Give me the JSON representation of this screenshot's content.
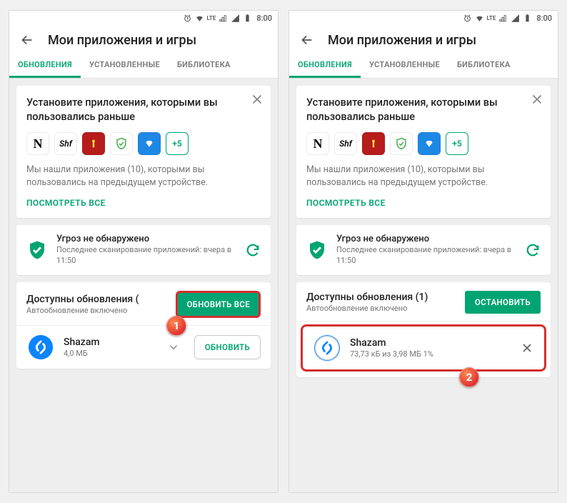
{
  "status": {
    "time": "8:00",
    "lte": "LTE"
  },
  "header": {
    "title": "Мои приложения и игры"
  },
  "tabs": {
    "updates": "ОБНОВЛЕНИЯ",
    "installed": "УСТАНОВЛЕННЫЕ",
    "library": "БИБЛИОТЕКА"
  },
  "suggest": {
    "title": "Установите приложения, которыми вы пользовались раньше",
    "more": "+5",
    "desc": "Мы нашли приложения (10), которыми вы пользовались на предыдущем устройстве.",
    "view_all": "ПОСМОТРЕТЬ ВСЕ"
  },
  "scan": {
    "title": "Угроз не обнаружено",
    "sub": "Последнее сканирование приложений: вчера в 11:50"
  },
  "left": {
    "upd_title": "Доступны обновления (",
    "upd_sub": "Автообновление включено",
    "btn_all": "ОБНОВИТЬ ВСЕ",
    "app_name": "Shazam",
    "app_sub": "4,0 МБ",
    "btn_one": "ОБНОВИТЬ"
  },
  "right": {
    "upd_title": "Доступны обновления (1)",
    "upd_sub": "Автообновление включено",
    "btn_stop": "ОСТАНОВИТЬ",
    "app_name": "Shazam",
    "app_sub": "73,73 кБ из 3,98 МБ  1%"
  },
  "callouts": {
    "one": "1",
    "two": "2"
  }
}
